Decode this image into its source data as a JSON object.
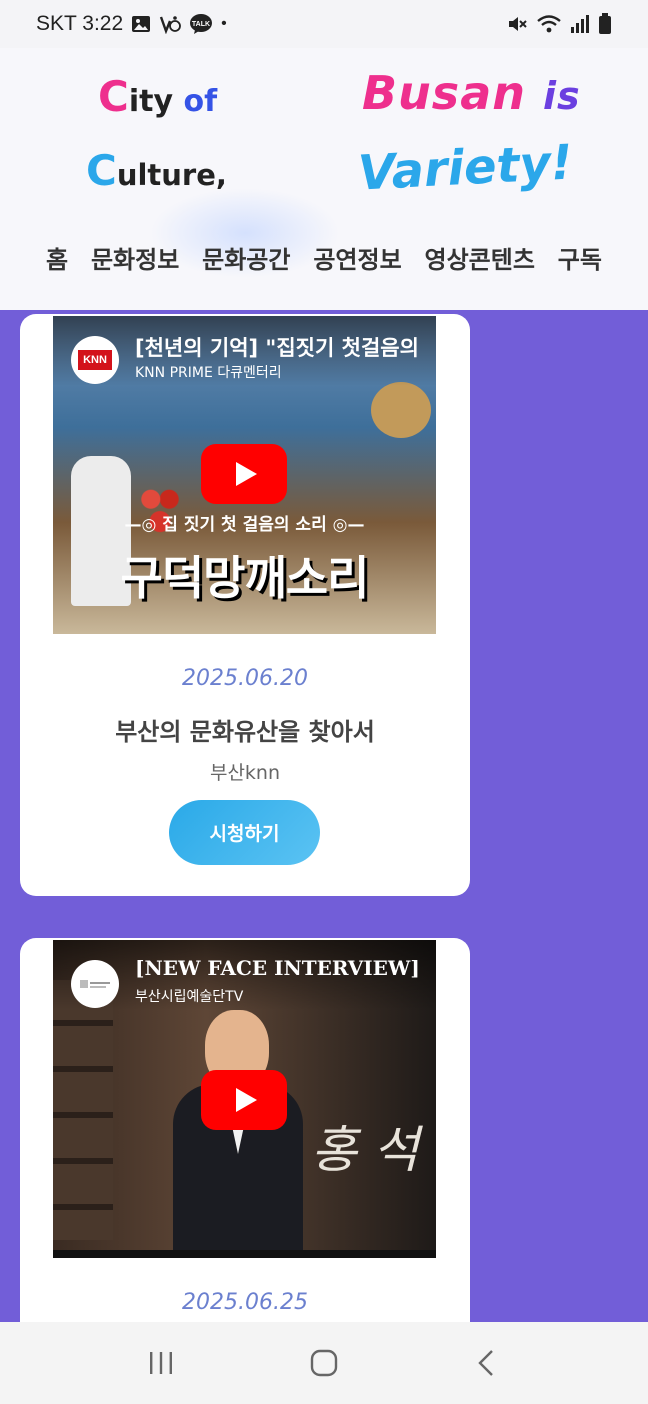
{
  "status_bar": {
    "time": "SKT 3:22",
    "dot": "•",
    "icons": [
      "gallery-icon",
      "accessibility-icon",
      "kakaotalk-icon",
      "mute-icon",
      "wifi-icon",
      "signal-icon",
      "battery-icon"
    ]
  },
  "header": {
    "logo": {
      "line1_cap": "C",
      "line1_rest": "ity ",
      "line1_of_o": "o",
      "line1_of_f": "f",
      "line2_cap": "C",
      "line2_rest": "ulture,",
      "busan": "Busan",
      "is": "is",
      "variety": "Variety!"
    },
    "nav": [
      "홈",
      "문화정보",
      "문화공간",
      "공연정보",
      "영상콘텐츠",
      "구독"
    ]
  },
  "cards": [
    {
      "thumbnail": {
        "title": "[천년의 기억] \"집짓기 첫걸음의",
        "channel": "KNN PRIME 다큐멘터리",
        "avatar_text": "KNN",
        "overlay_sub": "—◎ 집 짓기 첫 걸음의 소리 ◎—",
        "overlay_main": "구덕망깨소리"
      },
      "date": "2025.06.20",
      "title": "부산의 문화유산을 찾아서",
      "source": "부산knn",
      "button": "시청하기"
    },
    {
      "thumbnail": {
        "title": "[NEW FACE INTERVIEW]",
        "channel": "부산시립예술단TV",
        "calligraphy": "홍 석"
      },
      "date": "2025.06.25"
    }
  ],
  "colors": {
    "background": "#725ed8",
    "accent_pink": "#ee2f8d",
    "accent_blue": "#2ba7ea",
    "accent_purple": "#6b3fe0",
    "date": "#6b80cf",
    "play_red": "#ff0000"
  },
  "system_nav": [
    "recents-icon",
    "home-icon",
    "back-icon"
  ]
}
